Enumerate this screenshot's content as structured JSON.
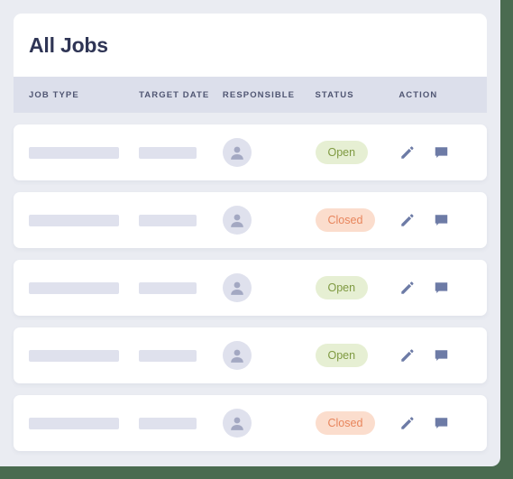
{
  "colors": {
    "backdrop": "#4a6b50",
    "page_background": "#eaecf2",
    "card": "#ffffff",
    "table_header_bg": "#dcdfeb",
    "title_text": "#2f3555",
    "header_text": "#4f5572",
    "placeholder_bar": "#dfe1ed",
    "avatar_bg": "#dfe1ed",
    "avatar_glyph": "#a3a8c2",
    "badge_open_bg": "#e6efd3",
    "badge_open_text": "#7f9a41",
    "badge_closed_bg": "#fbddcd",
    "badge_closed_text": "#e8855c",
    "action_icon": "#6d7ba6"
  },
  "panel": {
    "title": "All Jobs"
  },
  "table": {
    "columns": [
      {
        "key": "job_type",
        "label": "JOB TYPE"
      },
      {
        "key": "target_date",
        "label": "TARGET DATE"
      },
      {
        "key": "responsible",
        "label": "RESPONSIBLE"
      },
      {
        "key": "status",
        "label": "STATUS"
      },
      {
        "key": "action",
        "label": "ACTION"
      }
    ],
    "rows": [
      {
        "job_type": "",
        "target_date": "",
        "responsible_icon": "person-icon",
        "status": "Open",
        "status_variant": "open",
        "actions": [
          "pencil-icon",
          "comment-icon"
        ]
      },
      {
        "job_type": "",
        "target_date": "",
        "responsible_icon": "person-icon",
        "status": "Closed",
        "status_variant": "closed",
        "actions": [
          "pencil-icon",
          "comment-icon"
        ]
      },
      {
        "job_type": "",
        "target_date": "",
        "responsible_icon": "person-icon",
        "status": "Open",
        "status_variant": "open",
        "actions": [
          "pencil-icon",
          "comment-icon"
        ]
      },
      {
        "job_type": "",
        "target_date": "",
        "responsible_icon": "person-icon",
        "status": "Open",
        "status_variant": "open",
        "actions": [
          "pencil-icon",
          "comment-icon"
        ]
      },
      {
        "job_type": "",
        "target_date": "",
        "responsible_icon": "person-icon",
        "status": "Closed",
        "status_variant": "closed",
        "actions": [
          "pencil-icon",
          "comment-icon"
        ]
      }
    ]
  }
}
